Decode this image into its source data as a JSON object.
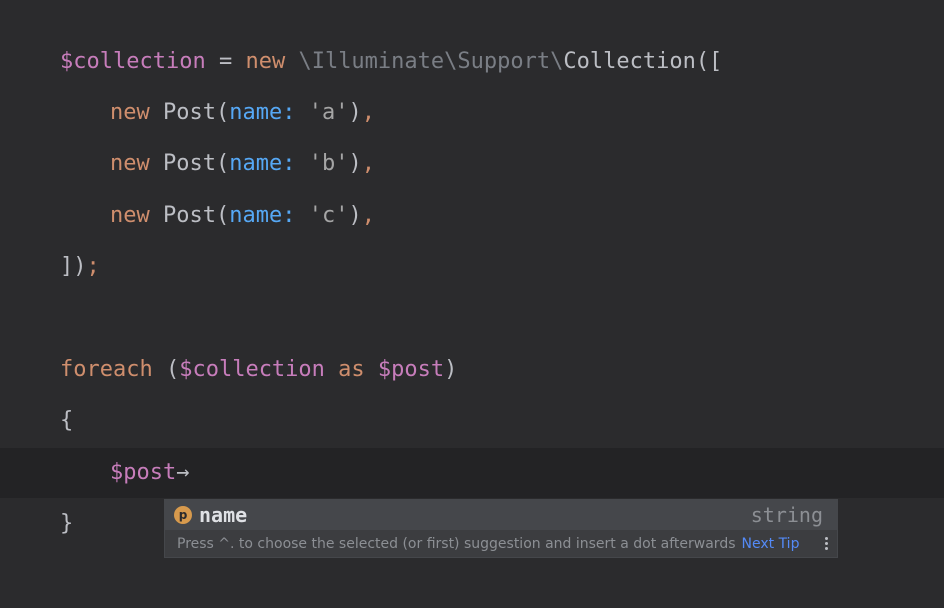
{
  "code": {
    "l1": {
      "var": "$collection",
      "assign": " = ",
      "new": "new",
      "space": " ",
      "ns": "\\Illuminate\\Support\\",
      "cls": "Collection",
      "open": "(["
    },
    "l2": {
      "new": "new",
      "cls": "Post",
      "open": "(",
      "param": "name:",
      "str": "'a'",
      "close": ")",
      "comma": ","
    },
    "l3": {
      "new": "new",
      "cls": "Post",
      "open": "(",
      "param": "name:",
      "str": "'b'",
      "close": ")",
      "comma": ","
    },
    "l4": {
      "new": "new",
      "cls": "Post",
      "open": "(",
      "param": "name:",
      "str": "'c'",
      "close": ")",
      "comma": ","
    },
    "l5": {
      "close": "])",
      "semi": ";"
    },
    "l6": {
      "kw": "foreach",
      "open": " (",
      "var": "$collection",
      "as": "as",
      "var2": "$post",
      "close": ")"
    },
    "l7": {
      "brace": "{"
    },
    "l8": {
      "var": "$post",
      "arrow": "→"
    },
    "l9": {
      "brace": "}"
    }
  },
  "completion": {
    "icon_letter": "p",
    "item_name": "name",
    "item_type": "string",
    "hint": "Press ^. to choose the selected (or first) suggestion and insert a dot afterwards",
    "next_tip": "Next Tip"
  },
  "colors": {
    "background": "#2b2b2d",
    "variable": "#c77dbb",
    "keyword": "#cf8e6d",
    "param": "#56a8f5",
    "link": "#548af7"
  }
}
